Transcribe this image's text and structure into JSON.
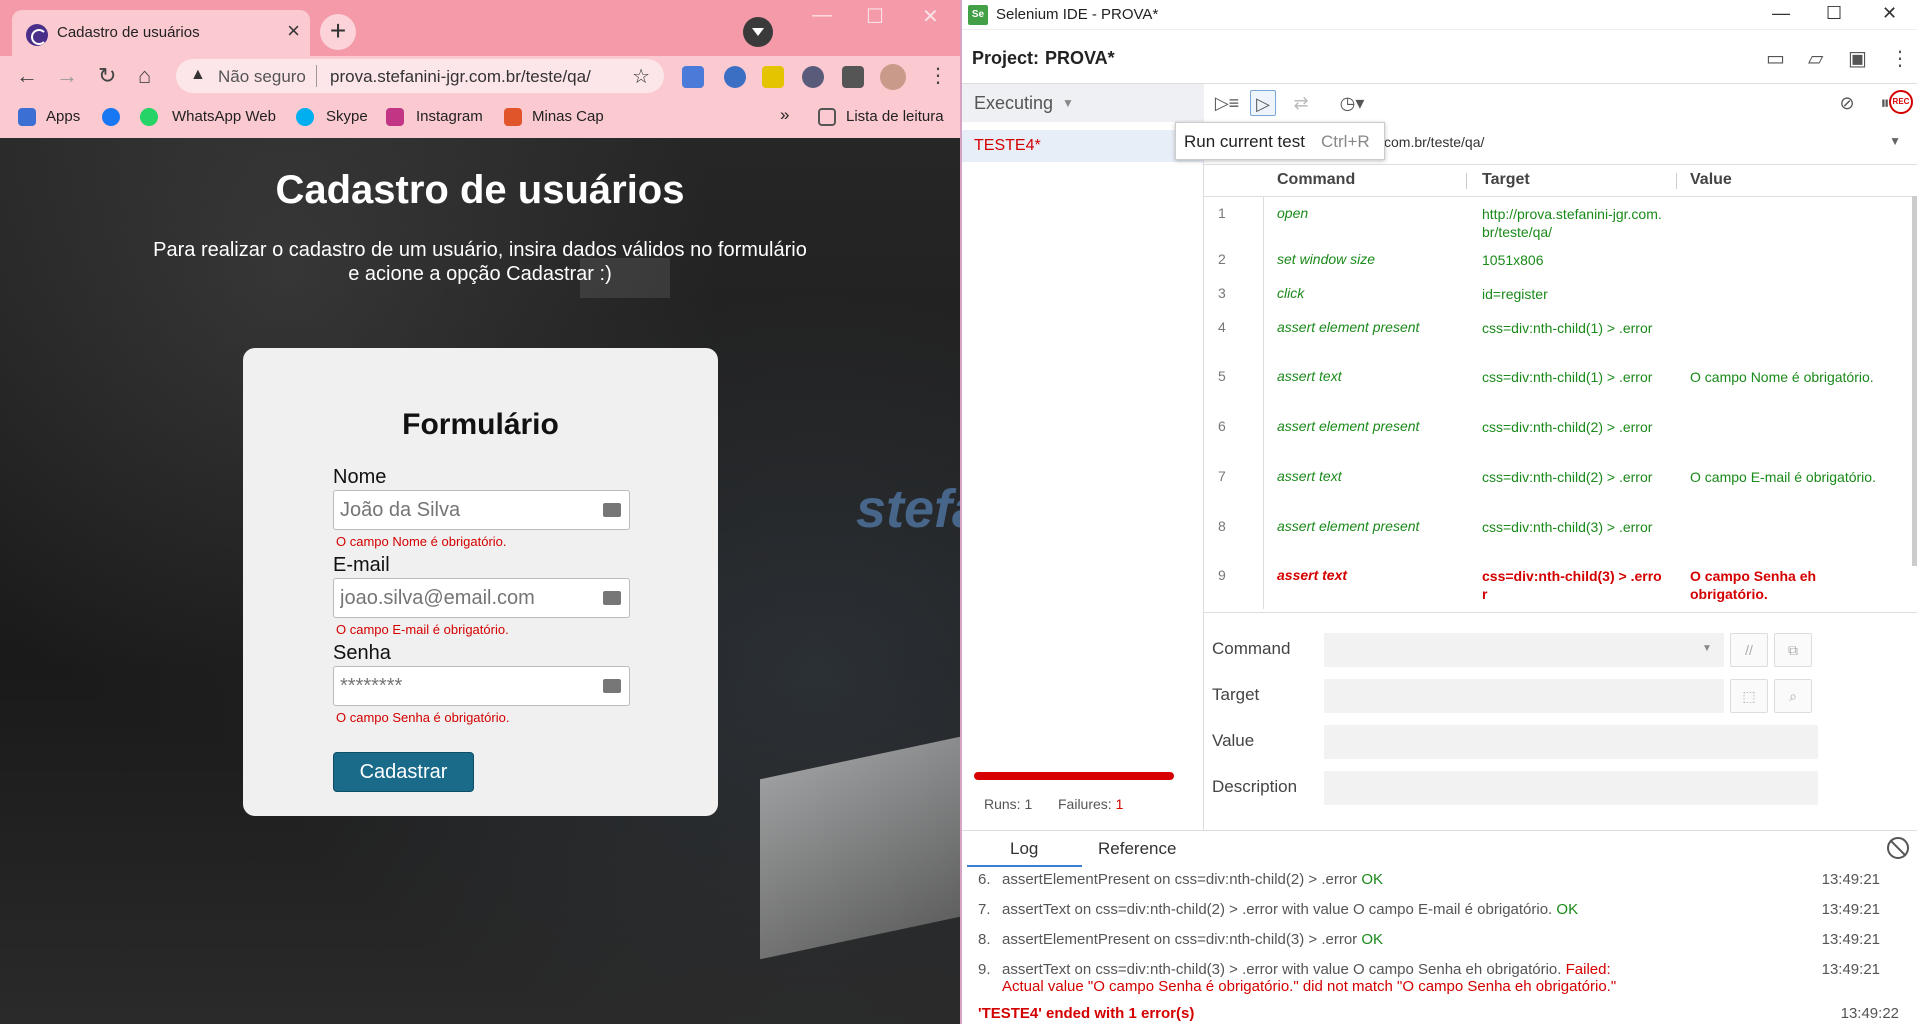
{
  "browser": {
    "tab_title": "Cadastro de usuários",
    "security_label": "Não seguro",
    "url": "prova.stefanini-jgr.com.br/teste/qa/",
    "bookmarks": [
      "Apps",
      "WhatsApp Web",
      "Skype",
      "Instagram",
      "Minas Cap"
    ],
    "reading_list": "Lista de leitura",
    "more": "»"
  },
  "page": {
    "heading": "Cadastro de usuários",
    "intro_line1": "Para realizar o cadastro de um usuário, insira dados válidos no formulário",
    "intro_line2": "e acione a opção Cadastrar :)",
    "form": {
      "title": "Formulário",
      "fields": [
        {
          "label": "Nome",
          "placeholder": "João da Silva",
          "error": "O campo Nome é obrigatório."
        },
        {
          "label": "E-mail",
          "placeholder": "joao.silva@email.com",
          "error": "O campo E-mail é obrigatório."
        },
        {
          "label": "Senha",
          "placeholder": "********",
          "error": "O campo Senha é obrigatório."
        }
      ],
      "submit": "Cadastrar"
    }
  },
  "ide": {
    "window_title": "Selenium IDE - PROVA*",
    "project_label": "Project:",
    "project_name": "PROVA*",
    "executing": "Executing",
    "test_name": "TESTE4*",
    "tooltip": {
      "label": "Run current test",
      "shortcut": "Ctrl+R"
    },
    "base_url": "com.br/teste/qa/",
    "columns": {
      "command": "Command",
      "target": "Target",
      "value": "Value"
    },
    "commands": [
      {
        "n": "1",
        "command": "open",
        "target": "http://prova.stefanini-jgr.com.br/teste/qa/",
        "value": ""
      },
      {
        "n": "2",
        "command": "set window size",
        "target": "1051x806",
        "value": ""
      },
      {
        "n": "3",
        "command": "click",
        "target": "id=register",
        "value": ""
      },
      {
        "n": "4",
        "command": "assert element present",
        "target": "css=div:nth-child(1) > .error",
        "value": ""
      },
      {
        "n": "5",
        "command": "assert text",
        "target": "css=div:nth-child(1) > .error",
        "value": "O campo Nome é obrigatório."
      },
      {
        "n": "6",
        "command": "assert element present",
        "target": "css=div:nth-child(2) > .error",
        "value": ""
      },
      {
        "n": "7",
        "command": "assert text",
        "target": "css=div:nth-child(2) > .error",
        "value": "O campo E-mail é obrigatório."
      },
      {
        "n": "8",
        "command": "assert element present",
        "target": "css=div:nth-child(3) > .error",
        "value": ""
      },
      {
        "n": "9",
        "command": "assert text",
        "target": "css=div:nth-child(3) > .error",
        "value": "O campo Senha eh obrigatório.",
        "failed": true
      }
    ],
    "editor": {
      "command": "Command",
      "target": "Target",
      "value": "Value",
      "description": "Description",
      "comment_btn": "//"
    },
    "runs_label": "Runs: 1",
    "failures_label": "Failures:",
    "failures_count": "1",
    "log_tabs": [
      "Log",
      "Reference"
    ],
    "log": [
      {
        "n": "6.",
        "text": "assertElementPresent on css=div:nth-child(2) > .error",
        "status": "OK",
        "time": "13:49:21"
      },
      {
        "n": "7.",
        "text": "assertText on css=div:nth-child(2) > .error with value O campo E-mail é obrigatório.",
        "status": "OK",
        "time": "13:49:21"
      },
      {
        "n": "8.",
        "text": "assertElementPresent on css=div:nth-child(3) > .error",
        "status": "OK",
        "time": "13:49:21"
      },
      {
        "n": "9.",
        "text": "assertText on css=div:nth-child(3) > .error with value O campo Senha eh obrigatório.",
        "status": "Failed:",
        "detail": "Actual value \"O campo Senha é obrigatório.\" did not match \"O campo Senha eh obrigatório.\"",
        "time": "13:49:21"
      }
    ],
    "end_message": "'TESTE4' ended with 1 error(s)",
    "end_time": "13:49:22"
  },
  "colors": {
    "tab_bar": "#f49aa9",
    "error": "#d40000",
    "ok": "#1a8a1a",
    "submit": "#1a6a8a"
  }
}
